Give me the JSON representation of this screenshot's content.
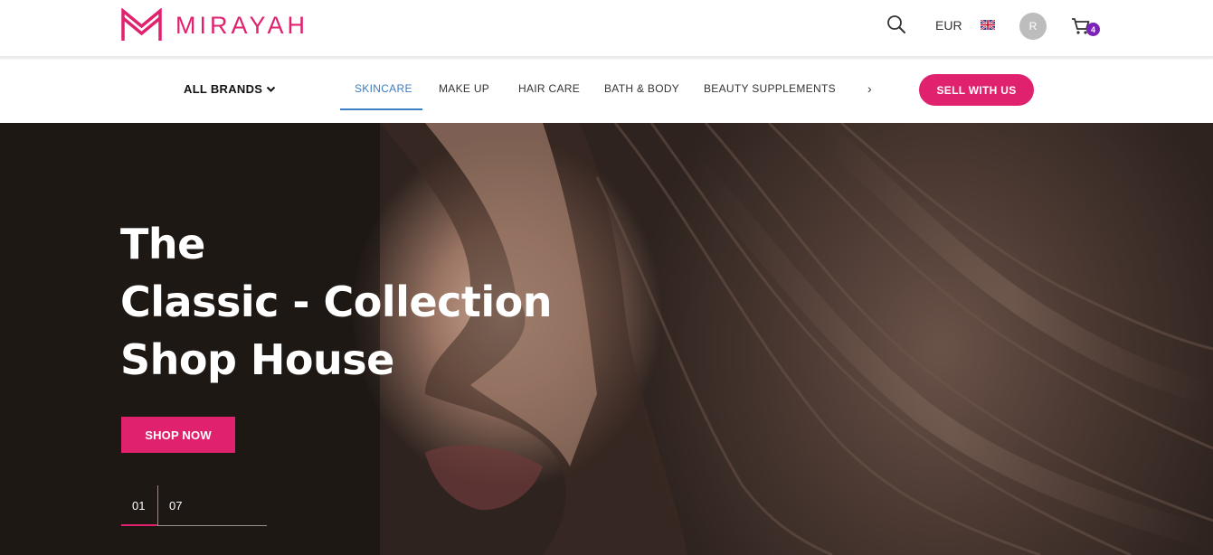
{
  "header": {
    "logo_text": "MIRAYAH",
    "currency": "EUR",
    "avatar_initial": "R",
    "cart_count": "4"
  },
  "nav": {
    "all_brands": "ALL BRANDS",
    "items": [
      {
        "label": "SKINCARE",
        "active": true
      },
      {
        "label": "MAKE UP"
      },
      {
        "label": "HAIR CARE"
      },
      {
        "label": "BATH & BODY"
      },
      {
        "label": "BEAUTY SUPPLEMENTS"
      }
    ],
    "more": "›",
    "sell_button": "SELL WITH US"
  },
  "hero": {
    "title_lines": [
      "The",
      "Classic - Collection",
      "Shop House"
    ],
    "cta": "SHOP NOW",
    "slide_current": "01",
    "slide_total": "07"
  },
  "colors": {
    "brand": "#e0226e",
    "nav_active": "#3a7ec4",
    "cart_badge": "#7b22b8"
  },
  "icons": [
    "m-logo-icon",
    "search-icon",
    "uk-flag-icon",
    "cart-icon",
    "chevron-down-icon"
  ]
}
